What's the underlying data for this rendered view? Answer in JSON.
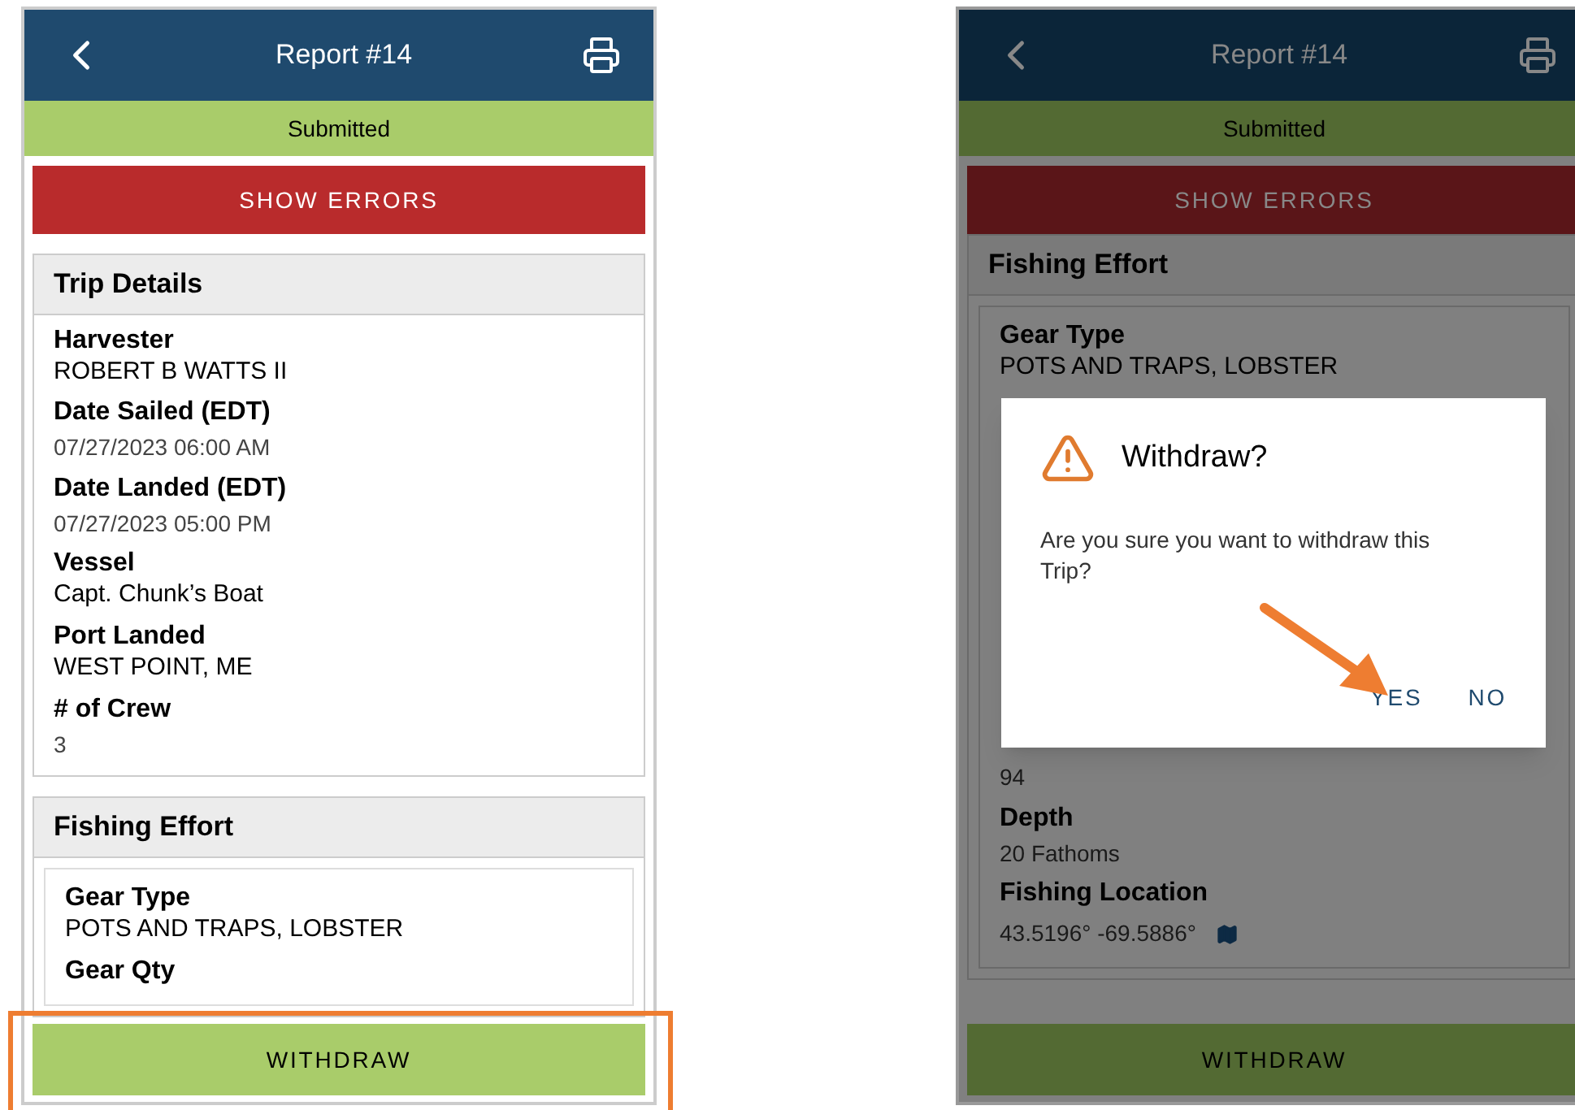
{
  "screens": [
    {
      "dimmed": false,
      "header": {
        "title": "Report #14"
      },
      "status": "Submitted",
      "errors_button": "SHOW ERRORS",
      "sections": [
        {
          "title": "Trip Details",
          "nested": false,
          "fields": [
            {
              "label": "Harvester",
              "value": "ROBERT B WATTS II",
              "kind": "plain"
            },
            {
              "label": "Date Sailed (EDT)",
              "value": "07/27/2023 06:00 AM",
              "kind": "muted"
            },
            {
              "label": "Date Landed (EDT)",
              "value": "07/27/2023 05:00 PM",
              "kind": "muted"
            },
            {
              "label": "Vessel",
              "value": "Capt. Chunk’s Boat",
              "kind": "plain"
            },
            {
              "label": "Port Landed",
              "value": "WEST POINT, ME",
              "kind": "plain"
            },
            {
              "label": "# of Crew",
              "value": "3",
              "kind": "muted"
            }
          ]
        },
        {
          "title": "Fishing Effort",
          "nested": true,
          "fields": [
            {
              "label": "Gear Type",
              "value": "POTS AND TRAPS, LOBSTER",
              "kind": "plain"
            },
            {
              "label": "Gear Qty",
              "kind": "plain"
            }
          ]
        }
      ],
      "withdraw_button": "WITHDRAW",
      "highlighted": true
    },
    {
      "dimmed": true,
      "header": {
        "title": "Report #14"
      },
      "status": "Submitted",
      "errors_button": "SHOW ERRORS",
      "sections": [
        {
          "title": "Fishing Effort",
          "nested": true,
          "fields": [
            {
              "label": "Gear Type",
              "value": "POTS AND TRAPS, LOBSTER",
              "kind": "plain"
            },
            {
              "kind": "hidden"
            },
            {
              "value": "94",
              "kind": "muted"
            },
            {
              "label": "Depth",
              "value": "20 Fathoms",
              "kind": "muted"
            },
            {
              "label": "Fishing Location",
              "value": "43.5196° -69.5886°",
              "kind": "location"
            }
          ]
        }
      ],
      "withdraw_button": "WITHDRAW",
      "highlighted": false,
      "dialog": {
        "title": "Withdraw?",
        "message": "Are you sure you want to withdraw this Trip?",
        "buttons": [
          "YES",
          "NO"
        ],
        "arrow": true
      }
    }
  ]
}
